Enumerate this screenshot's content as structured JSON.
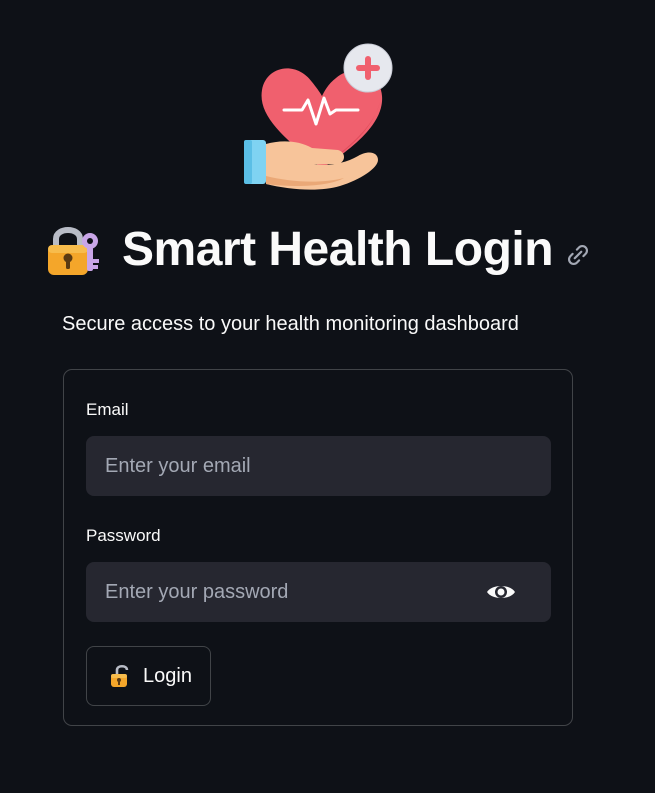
{
  "header": {
    "logo_icon": "heart-in-hand-icon",
    "title_emoji_icon": "locked-with-key-icon",
    "title": "Smart Health Login",
    "anchor_icon": "link-icon"
  },
  "subtitle": "Secure access to your health monitoring dashboard",
  "form": {
    "email": {
      "label": "Email",
      "value": "",
      "placeholder": "Enter your email"
    },
    "password": {
      "label": "Password",
      "value": "",
      "placeholder": "Enter your password",
      "toggle_icon": "eye-icon"
    },
    "login_button": {
      "label": "Login",
      "icon": "unlocked-icon"
    }
  },
  "colors": {
    "background": "#0e1117",
    "input_background": "#262730",
    "text": "#fafafa",
    "placeholder": "#a3a8b4",
    "heart": "#f0606e"
  }
}
